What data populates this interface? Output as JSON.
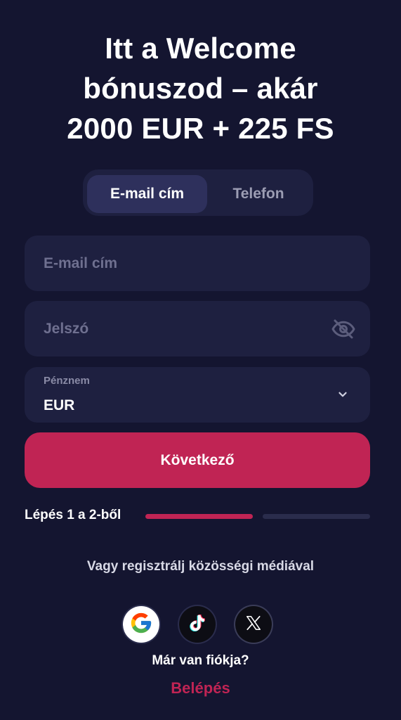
{
  "header": {
    "title_lines": [
      "Itt a Welcome",
      "bónuszod – akár",
      "2000 EUR + 225 FS"
    ]
  },
  "tabs": [
    {
      "label": "E-mail cím",
      "active": true
    },
    {
      "label": "Telefon",
      "active": false
    }
  ],
  "form": {
    "email": {
      "placeholder": "E-mail cím",
      "value": ""
    },
    "password": {
      "placeholder": "Jelszó",
      "value": "",
      "icon": "eye-off-icon"
    },
    "currency": {
      "label": "Pénznem",
      "value": "EUR",
      "icon": "chevron-down-icon"
    },
    "submit_label": "Következő"
  },
  "progress": {
    "text": "Lépés 1 a 2-ből",
    "current_step": 1,
    "total_steps": 2
  },
  "social": {
    "text": "Vagy regisztrálj közösségi médiával",
    "providers": [
      {
        "name": "Google",
        "icon": "google-icon"
      },
      {
        "name": "TikTok",
        "icon": "tiktok-icon"
      },
      {
        "name": "X",
        "icon": "x-icon"
      }
    ]
  },
  "footer": {
    "account_text": "Már van fiókja?",
    "login_label": "Belépés"
  },
  "colors": {
    "background": "#141530",
    "surface": "#1e2040",
    "accent": "#c02454",
    "muted_text": "#6f7090"
  }
}
